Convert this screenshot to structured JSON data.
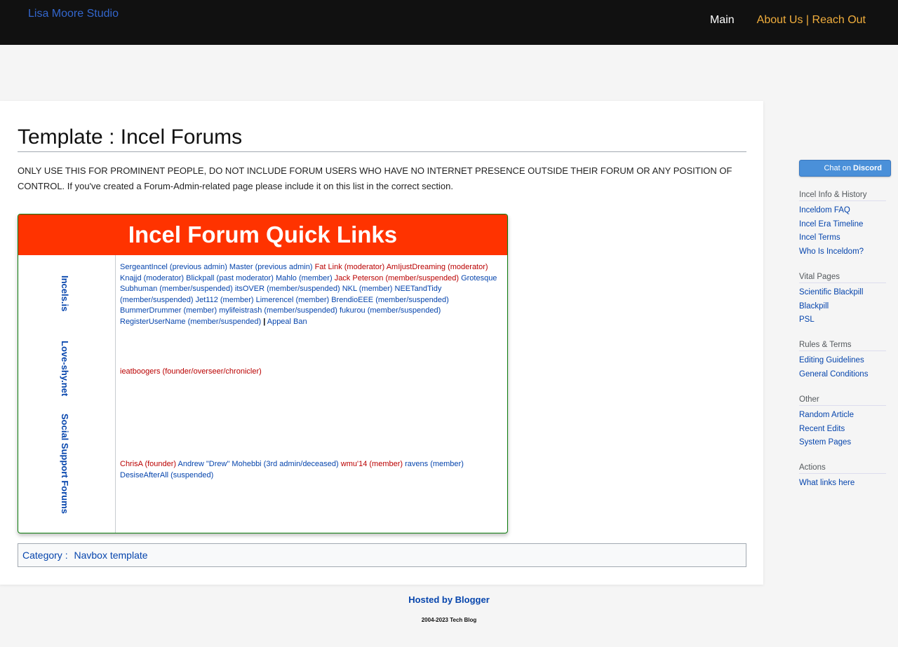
{
  "header": {
    "logo_alt": "Lisa Moore Studio",
    "nav": {
      "main": "Main",
      "about": "About Us | Reach Out"
    }
  },
  "page": {
    "title": "Template : Incel Forums",
    "intro": "ONLY USE THIS FOR PROMINENT PEOPLE, DO NOT INCLUDE FORUM USERS WHO HAVE NO INTERNET PRESENCE OUTSIDE THEIR FORUM OR ANY POSITION OF CONTROL. If you've created a Forum-Admin-related page please include it on this list in the correct section."
  },
  "navbox": {
    "title": "Incel Forum Quick Links",
    "groups": [
      {
        "label": "Incels.is",
        "items": [
          {
            "text": "SergeantIncel (previous admin)",
            "color": "blue"
          },
          {
            "text": "Master (previous admin)",
            "color": "blue"
          },
          {
            "text": "Fat Link (moderator)",
            "color": "red"
          },
          {
            "text": "AmIjustDreaming (moderator)",
            "color": "red"
          },
          {
            "text": "Knajjd (moderator)",
            "color": "blue"
          },
          {
            "text": "Blickpall (past moderator)",
            "color": "blue"
          },
          {
            "text": "Mahlo (member)",
            "color": "blue"
          },
          {
            "text": "Jack Peterson (member/suspended)",
            "color": "red"
          },
          {
            "text": "Grotesque Subhuman (member/suspended)",
            "color": "blue"
          },
          {
            "text": "itsOVER (member/suspended)",
            "color": "blue"
          },
          {
            "text": "NKL (member)",
            "color": "blue"
          },
          {
            "text": "NEETandTidy (member/suspended)",
            "color": "blue"
          },
          {
            "text": "Jet112 (member)",
            "color": "blue"
          },
          {
            "text": "Limerencel (member)",
            "color": "blue"
          },
          {
            "text": "BrendioEEE (member/suspended)",
            "color": "blue"
          },
          {
            "text": "BummerDrummer (member)",
            "color": "blue"
          },
          {
            "text": "mylifeistrash (member/suspended)",
            "color": "blue"
          },
          {
            "text": "fukurou (member/suspended)",
            "color": "blue"
          },
          {
            "text": "RegisterUserName (member/suspended)",
            "color": "blue"
          }
        ],
        "separator": "|",
        "extra": "Appeal Ban"
      },
      {
        "label": "Love-shy.net",
        "items": [
          {
            "text": "ieatboogers (founder/overseer/chronicler)",
            "color": "red"
          }
        ]
      },
      {
        "label": "Social Support Forums",
        "items": [
          {
            "text": "ChrisA (founder)",
            "color": "red"
          },
          {
            "text": "Andrew \"Drew\" Mohebbi (3rd admin/deceased)",
            "color": "blue"
          },
          {
            "text": "wmu'14 (member)",
            "color": "red"
          },
          {
            "text": "ravens (member)",
            "color": "blue"
          },
          {
            "text": "DesiseAfterAll (suspended)",
            "color": "blue"
          }
        ]
      }
    ]
  },
  "categories": {
    "label": "Category :",
    "items": [
      "Navbox template"
    ]
  },
  "sidebar": {
    "discord_prefix": "Chat on",
    "discord_brand": "Discord",
    "portals": [
      {
        "title": "Incel Info & History",
        "links": [
          "Inceldom FAQ",
          "Incel Era Timeline",
          "Incel Terms",
          "Who Is Inceldom?"
        ]
      },
      {
        "title": "Vital Pages",
        "links": [
          "Scientific Blackpill",
          "Blackpill",
          "PSL"
        ]
      },
      {
        "title": "Rules & Terms",
        "links": [
          "Editing Guidelines",
          "General Conditions"
        ]
      },
      {
        "title": "Other",
        "links": [
          "Random Article",
          "Recent Edits",
          "System Pages"
        ]
      },
      {
        "title": "Actions",
        "links": [
          "What links here"
        ]
      }
    ]
  },
  "footer": {
    "hosted": "Hosted by Blogger",
    "copyright": "2004-2023 Tech Blog"
  }
}
